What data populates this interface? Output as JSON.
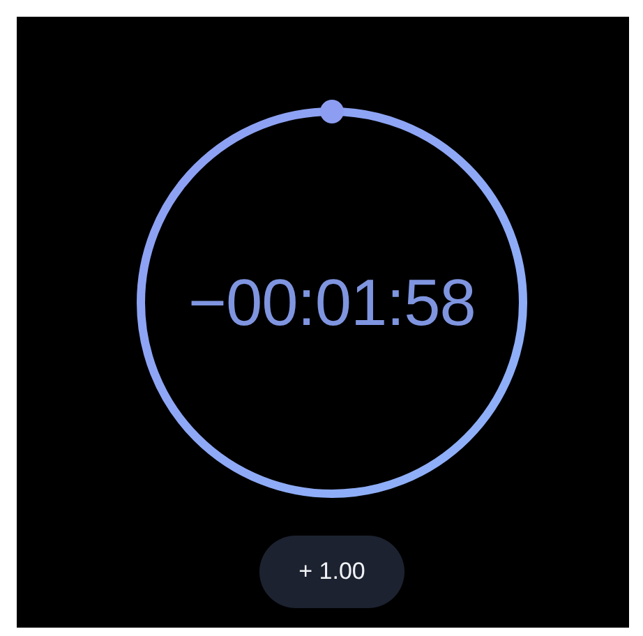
{
  "timer": {
    "remaining": "−00:01:58"
  },
  "buttons": [
    {
      "label": "+ 1.00"
    }
  ]
}
